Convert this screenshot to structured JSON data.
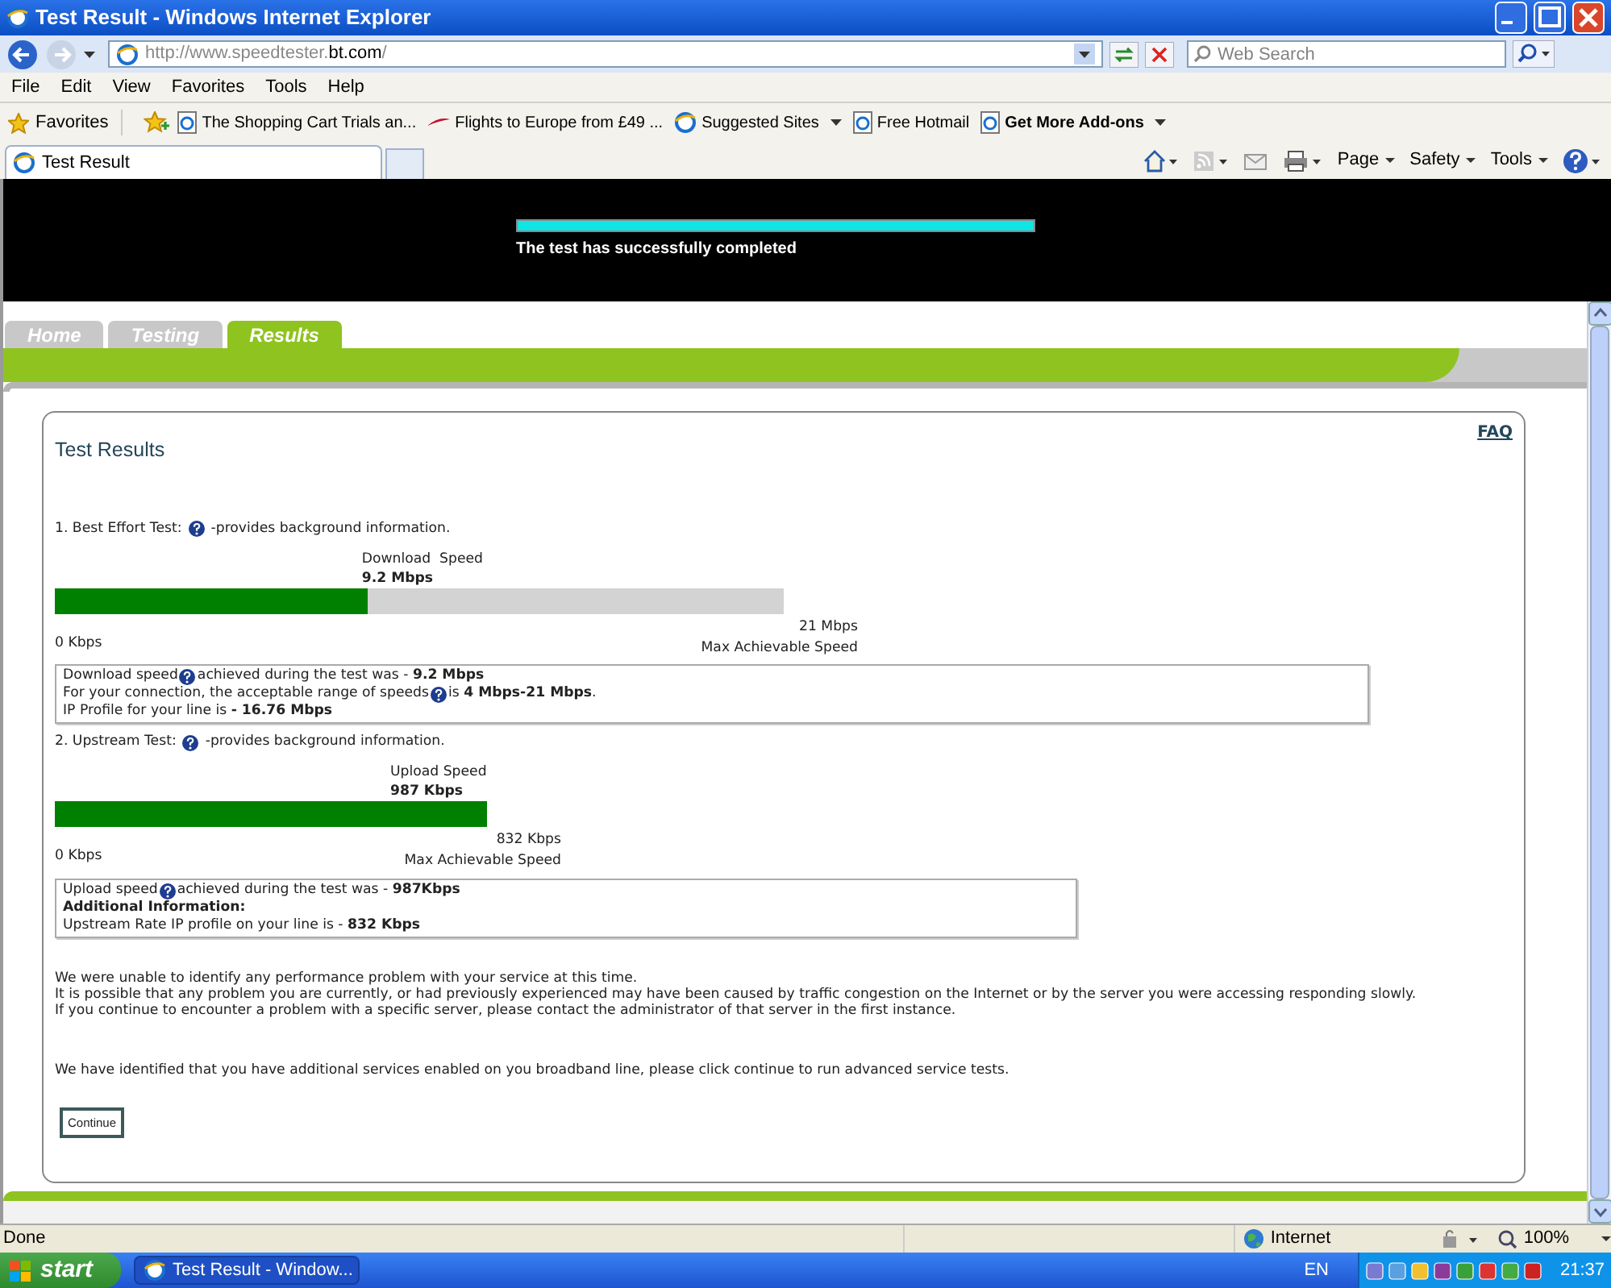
{
  "window": {
    "title": "Test Result - Windows Internet Explorer"
  },
  "address_bar": {
    "url_prefix": "http://www.speedtester.",
    "url_domain": "bt.com",
    "url_suffix": "/"
  },
  "search": {
    "placeholder": "Web Search"
  },
  "menu": [
    "File",
    "Edit",
    "View",
    "Favorites",
    "Tools",
    "Help"
  ],
  "favorites_bar": {
    "label": "Favorites",
    "items": [
      {
        "label": "The Shopping Cart  Trials an...",
        "kind": "page",
        "dropdown": false,
        "bold": false
      },
      {
        "label": "Flights to Europe from £49  ...",
        "kind": "airline",
        "dropdown": false,
        "bold": false
      },
      {
        "label": "Suggested Sites",
        "kind": "sites",
        "dropdown": true,
        "bold": false
      },
      {
        "label": "Free Hotmail",
        "kind": "page",
        "dropdown": false,
        "bold": false
      },
      {
        "label": "Get More Add-ons",
        "kind": "page",
        "dropdown": true,
        "bold": true
      }
    ]
  },
  "browser_tab": {
    "label": "Test Result"
  },
  "command_bar": [
    "Page",
    "Safety",
    "Tools"
  ],
  "page": {
    "banner": {
      "level": 1,
      "message": "The test has successfully completed"
    },
    "nav_tabs": [
      {
        "label": "Home",
        "selected": false
      },
      {
        "label": "Testing",
        "selected": false
      },
      {
        "label": "Results",
        "selected": true
      }
    ],
    "card": {
      "title": "Test Results",
      "faq": "FAQ",
      "tests": [
        {
          "heading": "1. Best Effort Test:",
          "hint": "-provides background information.",
          "speed_label": "Download  Speed",
          "speed_value": "9.2 Mbps",
          "level": 0.43,
          "min_label": "0 Kbps",
          "max_value": "21 Mbps",
          "max_label": "Max Achievable Speed",
          "info": [
            {
              "parts": [
                "Download speed",
                "achieved during the test was - **9.2 Mbps**"
              ],
              "bold": false
            },
            {
              "parts": [
                "For your connection, the acceptable range of speeds",
                "is **4 Mbps-21 Mbps**."
              ],
              "bold": false
            },
            {
              "parts": [
                "IP Profile for your line is **- 16.76 Mbps**"
              ],
              "bold": false
            }
          ]
        },
        {
          "heading": "2. Upstream Test:",
          "hint": "-provides background information.",
          "speed_label": "Upload Speed",
          "speed_value": "987 Kbps",
          "level": 1,
          "min_label": "0 Kbps",
          "max_value": "832 Kbps",
          "max_label": "Max Achievable Speed",
          "info": [
            {
              "parts": [
                "Upload speed",
                "achieved during the test was - **987Kbps**"
              ],
              "bold": false
            },
            {
              "parts": [
                "Additional Information:"
              ],
              "bold": true
            },
            {
              "parts": [
                "Upstream Rate IP profile on your line is - **832 Kbps**"
              ],
              "bold": false
            }
          ]
        }
      ],
      "paragraphs": [
        "We were unable to identify any performance problem with your service at this time.",
        "It is possible that any problem you are currently, or had previously experienced may have been caused by traffic congestion on the Internet or by the server you were accessing responding slowly.",
        "If you continue to encounter a problem with a specific server, please contact the administrator of that server in the first instance."
      ],
      "notice": "We have identified that you have additional services enabled on you broadband line, please click continue to run advanced service tests.",
      "button": "Continue"
    }
  },
  "status_bar": {
    "text": "Done",
    "zone": "Internet",
    "zoom": "100%"
  },
  "taskbar": {
    "start": "start",
    "task": "Test Result - Window...",
    "language": "EN",
    "clock": "21:37"
  }
}
